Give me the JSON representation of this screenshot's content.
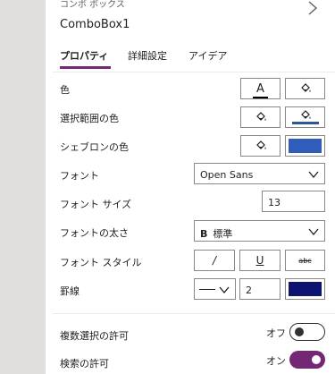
{
  "header": {
    "subtitle": "コンボ ボックス",
    "control_name": "ComboBox1"
  },
  "tabs": [
    {
      "label": "プロパティ",
      "active": true
    },
    {
      "label": "詳細設定",
      "active": false
    },
    {
      "label": "アイデア",
      "active": false
    }
  ],
  "properties": {
    "color": {
      "label": "色",
      "text_color_glyph": "A"
    },
    "selection_color": {
      "label": "選択範囲の色"
    },
    "chevron_color": {
      "label": "シェブロンの色"
    },
    "font": {
      "label": "フォント",
      "value": "Open Sans"
    },
    "font_size": {
      "label": "フォント サイズ",
      "value": "13"
    },
    "font_weight": {
      "label": "フォントの太さ",
      "value": "標準",
      "glyph": "B"
    },
    "font_style": {
      "label": "フォント スタイル",
      "italic_glyph": "/",
      "underline_glyph": "U",
      "strike_glyph": "abc"
    },
    "border": {
      "label": "罫線",
      "width": "2"
    }
  },
  "toggles": {
    "multi_select": {
      "label": "複数選択の許可",
      "state_text": "オフ",
      "on": false
    },
    "search": {
      "label": "検索の許可",
      "state_text": "オン",
      "on": true
    }
  },
  "colors": {
    "accent": "#742774",
    "selection_fill": "#2b5797",
    "chevron_fill": "#2f5db9",
    "border_fill": "#0c1370"
  }
}
